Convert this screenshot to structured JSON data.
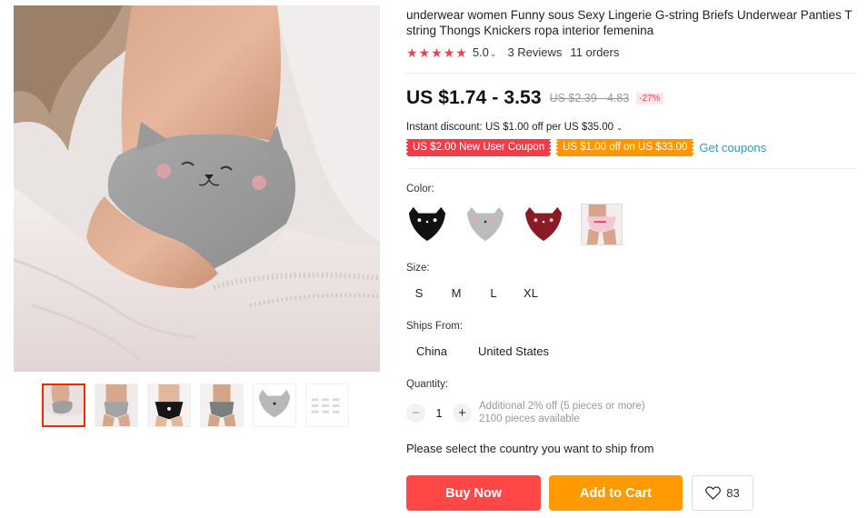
{
  "product": {
    "title": "underwear women Funny sous Sexy Lingerie G-string Briefs Underwear Panties T string Thongs Knickers ropa interior femenina"
  },
  "rating": {
    "stars": 5,
    "value": "5.0",
    "reviews": "3 Reviews",
    "orders": "11 orders",
    "star_color": "#f0404b"
  },
  "price": {
    "current": "US $1.74 - 3.53",
    "original": "US $2.39 - 4.83",
    "discount": "-27%"
  },
  "instant_discount": "Instant discount: US $1.00 off per US $35.00",
  "coupons": [
    {
      "label": "US $2.00 New User Coupon",
      "color": "#f53a48"
    },
    {
      "label": "US $1.00 off on US $33.00",
      "color": "#ff9600"
    }
  ],
  "get_coupons": "Get coupons",
  "color_section": {
    "label": "Color:",
    "options": [
      {
        "name": "black",
        "swatch": "#111111"
      },
      {
        "name": "gray",
        "swatch": "#b9b9b9"
      },
      {
        "name": "wine red",
        "swatch": "#8c1a24"
      },
      {
        "name": "photo",
        "swatch": "#f1dfe3"
      }
    ]
  },
  "size_section": {
    "label": "Size:",
    "options": [
      "S",
      "M",
      "L",
      "XL"
    ]
  },
  "ships_section": {
    "label": "Ships From:",
    "options": [
      "China",
      "United States"
    ]
  },
  "quantity_section": {
    "label": "Quantity:",
    "value": "1",
    "minus": "−",
    "plus": "+",
    "note_line1": "Additional 2% off (5 pieces or more)",
    "note_line2": "2100 pieces available"
  },
  "ship_message": "Please select the country you want to ship from",
  "actions": {
    "buy_now": "Buy Now",
    "add_to_cart": "Add to Cart",
    "wishlist_count": "83"
  },
  "gallery": {
    "thumbnails": [
      "thumb-1",
      "thumb-2",
      "thumb-3",
      "thumb-4",
      "thumb-5",
      "thumb-6"
    ],
    "active_index": 0
  }
}
